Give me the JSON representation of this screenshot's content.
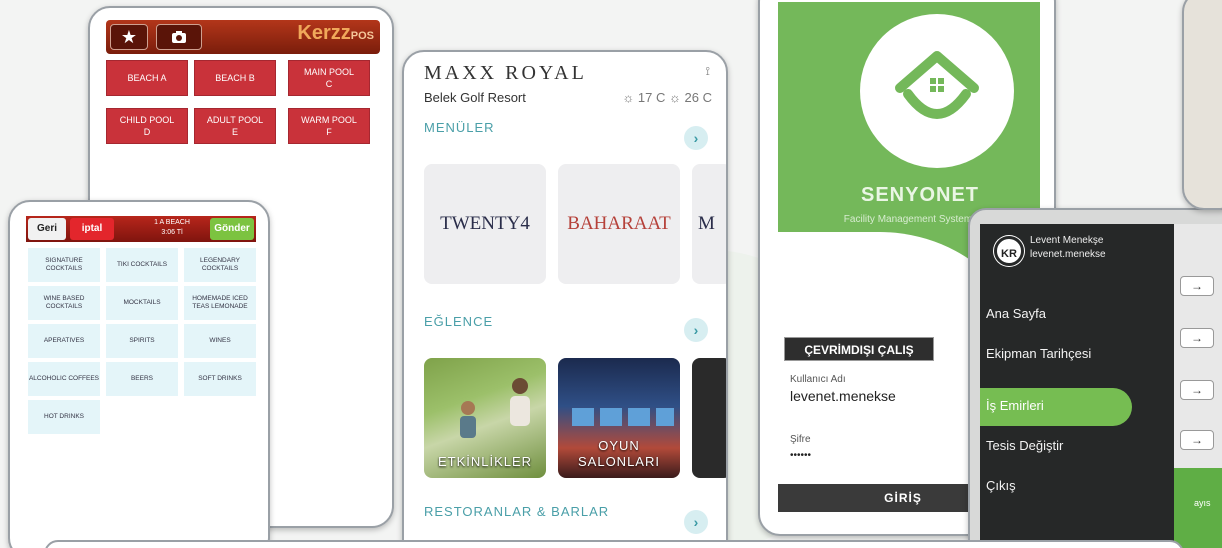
{
  "kerzz": {
    "logo_text": "Kerzz",
    "logo_suffix": "POS",
    "star_icon": "star-icon",
    "camera_icon": "camera-icon",
    "tiles": [
      {
        "line1": "BEACH A",
        "line2": ""
      },
      {
        "line1": "BEACH B",
        "line2": ""
      },
      {
        "line1": "MAIN POOL",
        "line2": "C"
      },
      {
        "line1": "CHILD POOL",
        "line2": "D"
      },
      {
        "line1": "ADULT POOL",
        "line2": "E"
      },
      {
        "line1": "WARM POOL",
        "line2": "F"
      }
    ],
    "tile_color": "#c9323a"
  },
  "order": {
    "back_label": "Geri",
    "cancel_label": "iptal",
    "title_line1": "1 A BEACH",
    "title_line2": "3:06 Tl",
    "send_label": "Gönder",
    "categories": [
      "SIGNATURE COCKTAILS",
      "TIKI COCKTAILS",
      "LEGENDARY COCKTAILS",
      "WINE BASED COCKTAILS",
      "MOCKTAILS",
      "HOMEMADE ICED TEAS LEMONADE",
      "APERATIVES",
      "SPIRITS",
      "WINES",
      "ALCOHOLIC COFFEES",
      "BEERS",
      "SOFT DRINKS",
      "HOT DRINKS"
    ]
  },
  "maxx": {
    "logo": "MAXX ROYAL",
    "resort": "Belek Golf Resort",
    "temp": "☼ 17 C ☼ 26 C",
    "net_icon": "wifi-icon",
    "sections": {
      "menus": "MENÜLER",
      "fun": "EĞLENCE",
      "restaurants": "RESTORANLAR & BARLAR"
    },
    "menu_cards": [
      "TWENTY4",
      "BAHARAAT",
      "M"
    ],
    "activity_cards": [
      "ETKİNLİKLER",
      "OYUN SALONLARI"
    ],
    "arrow": "›",
    "accent": "#4a9fa8"
  },
  "senyonet": {
    "title": "SENYONET",
    "tagline": "Facility Management System",
    "offline_label": "ÇEVRİMDIŞI ÇALIŞ",
    "user_label": "Kullanıcı Adı",
    "user_value": "levenet.menekse",
    "pass_label": "Şifre",
    "pass_value": "••••••",
    "login_label": "GİRİŞ",
    "brand_color": "#74b85a"
  },
  "drawer": {
    "avatar": "KR",
    "user_name": "Levent Menekşe",
    "user_handle": "levenet.menekse",
    "items": [
      "Ana Sayfa",
      "Ekipman Tarihçesi",
      "İş Emirleri",
      "Tesis Değiştir",
      "Çıkış"
    ],
    "active_index": 2,
    "arrow": "→",
    "right_text": "ayıs"
  }
}
